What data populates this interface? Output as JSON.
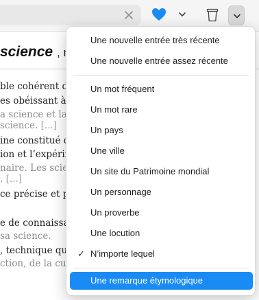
{
  "toolbar": {
    "search_value": "",
    "search_placeholder": "",
    "accent_color": "#1a8bf5",
    "icons": [
      "clear-icon",
      "heart-icon",
      "chevron-down-icon",
      "trash-icon",
      "chevron-down-icon"
    ]
  },
  "article": {
    "headword": "science",
    "head_rest": ", n",
    "lines": [
      {
        "text": "ble cohérent de",
        "ex": false,
        "ellipsis": ""
      },
      {
        "text": "es obéissant à c",
        "ex": false,
        "ellipsis": ""
      },
      {
        "text": "a science et la t",
        "ex": true,
        "ellipsis": ""
      },
      {
        "text": "science.",
        "ex": true,
        "ellipsis": "[...]"
      },
      {
        "text": "ine constitué d",
        "ex": false,
        "ellipsis": ""
      },
      {
        "text": "ion et l’expérim",
        "ex": false,
        "ellipsis": ""
      },
      {
        "text": "naire. Les scien",
        "ex": true,
        "ellipsis": ""
      },
      {
        "text": ".",
        "ex": true,
        "ellipsis": "[...]"
      },
      {
        "text": "ce précise et pr",
        "ex": false,
        "ellipsis": ""
      },
      {
        "text": "e de connaissar",
        "ex": false,
        "ellipsis": ""
      },
      {
        "text": "sa science.",
        "ex": true,
        "ellipsis": ""
      },
      {
        "text": ", technique qui",
        "ex": false,
        "ellipsis": ""
      },
      {
        "text": "ction, de la cui",
        "ex": true,
        "ellipsis": ""
      }
    ]
  },
  "menu": {
    "items": [
      {
        "label": "Une nouvelle entrée très récente",
        "checked": false,
        "highlighted": false
      },
      {
        "label": "Une nouvelle entrée assez récente",
        "checked": false,
        "highlighted": false
      },
      {
        "label": "Un mot fréquent",
        "checked": false,
        "highlighted": false
      },
      {
        "label": "Un mot rare",
        "checked": false,
        "highlighted": false
      },
      {
        "label": "Un pays",
        "checked": false,
        "highlighted": false
      },
      {
        "label": "Une ville",
        "checked": false,
        "highlighted": false
      },
      {
        "label": "Un site du Patrimoine mondial",
        "checked": false,
        "highlighted": false
      },
      {
        "label": "Un personnage",
        "checked": false,
        "highlighted": false
      },
      {
        "label": "Un proverbe",
        "checked": false,
        "highlighted": false
      },
      {
        "label": "Une locution",
        "checked": false,
        "highlighted": false
      },
      {
        "label": "N’importe lequel",
        "checked": true,
        "highlighted": false
      },
      {
        "label": "Une remarque étymologique",
        "checked": false,
        "highlighted": true
      }
    ],
    "check_glyph": "✓"
  }
}
